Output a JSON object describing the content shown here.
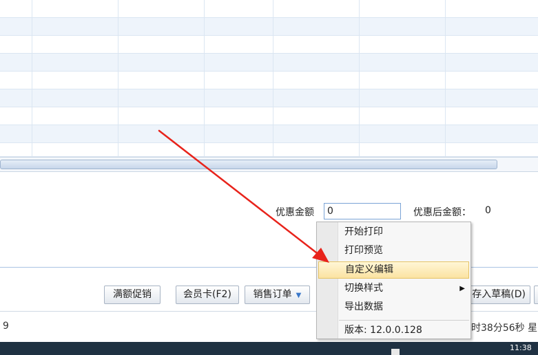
{
  "discount": {
    "label": "优惠金额",
    "value": "0",
    "after_label": "优惠后金额：",
    "after_value": "0"
  },
  "buttons": {
    "full_discount": "满额促销",
    "member_card": "会员卡(F2)",
    "sales_order": "销售订单",
    "save_draft": "存入草稿(D)"
  },
  "context_menu": {
    "items": [
      {
        "label": "开始打印"
      },
      {
        "label": "打印预览"
      },
      {
        "label": "自定义编辑"
      },
      {
        "label": "切换样式"
      },
      {
        "label": "导出数据"
      }
    ],
    "version": "版本: 12.0.0.128"
  },
  "status": {
    "left": "9",
    "time": "时38分56秒 星"
  },
  "taskbar": {
    "clock": "11:38"
  },
  "colors": {
    "accent": "#3a78c9",
    "menu_highlight": "#fbe3a2",
    "annotation_arrow": "#e8231b"
  }
}
